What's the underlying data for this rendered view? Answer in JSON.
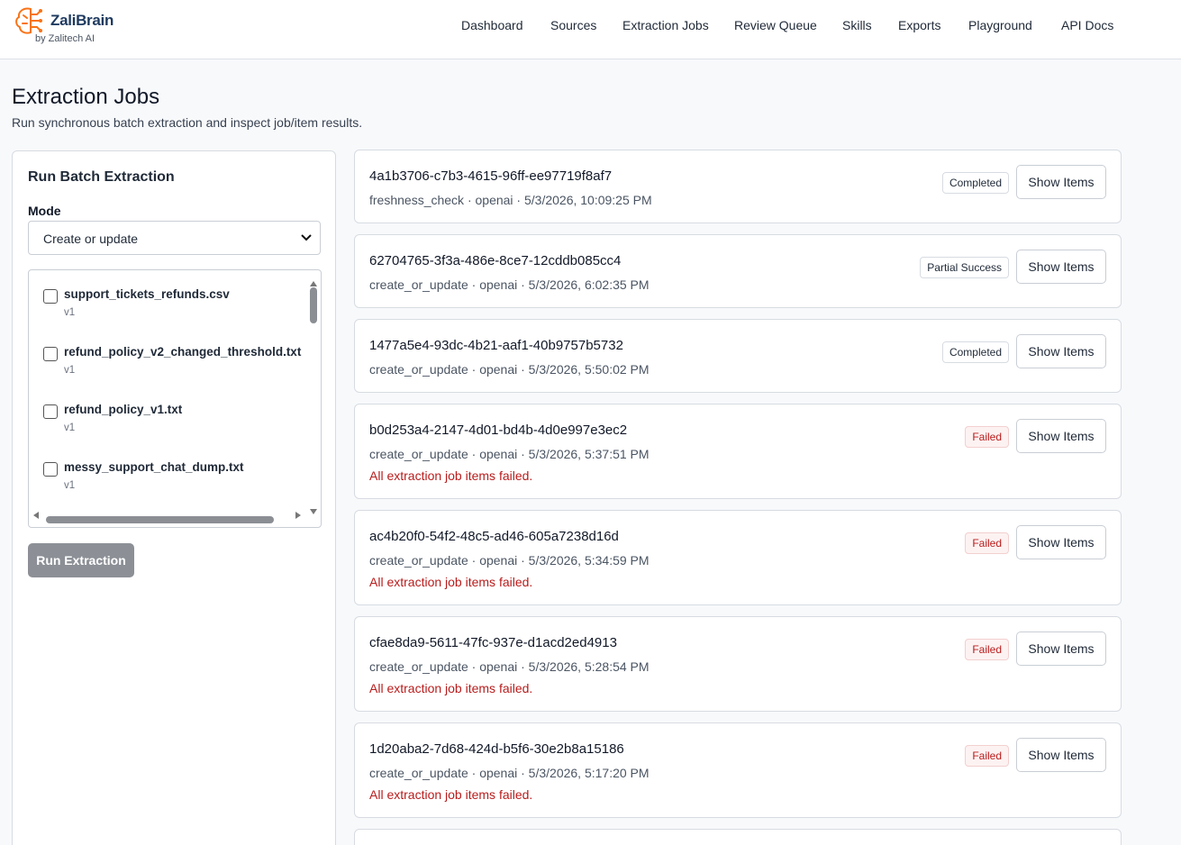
{
  "brand": {
    "name": "ZaliBrain",
    "tagline": "by Zalitech AI",
    "accent": "#f97316",
    "text_color": "#1e3a5f"
  },
  "nav": {
    "items": [
      {
        "label": "Dashboard"
      },
      {
        "label": "Sources"
      },
      {
        "label": "Extraction Jobs"
      },
      {
        "label": "Review Queue"
      },
      {
        "label": "Skills"
      },
      {
        "label": "Exports"
      },
      {
        "label": "Playground"
      },
      {
        "label": "API Docs"
      }
    ]
  },
  "page": {
    "title": "Extraction Jobs",
    "subtitle": "Run synchronous batch extraction and inspect job/item results."
  },
  "batch": {
    "title": "Run Batch Extraction",
    "mode_label": "Mode",
    "mode_value": "Create or update",
    "files": [
      {
        "name": "support_tickets_refunds.csv",
        "version": "v1",
        "checked": false
      },
      {
        "name": "refund_policy_v2_changed_threshold.txt",
        "version": "v1",
        "checked": false
      },
      {
        "name": "refund_policy_v1.txt",
        "version": "v1",
        "checked": false
      },
      {
        "name": "messy_support_chat_dump.txt",
        "version": "v1",
        "checked": false
      }
    ],
    "run_label": "Run Extraction",
    "run_disabled": true
  },
  "jobs": [
    {
      "id": "4a1b3706-c7b3-4615-96ff-ee97719f8af7",
      "meta": "freshness_check · openai · 5/3/2026, 10:09:25 PM",
      "status": "Completed",
      "error": "",
      "action": "Show Items"
    },
    {
      "id": "62704765-3f3a-486e-8ce7-12cddb085cc4",
      "meta": "create_or_update · openai · 5/3/2026, 6:02:35 PM",
      "status": "Partial Success",
      "error": "",
      "action": "Show Items"
    },
    {
      "id": "1477a5e4-93dc-4b21-aaf1-40b9757b5732",
      "meta": "create_or_update · openai · 5/3/2026, 5:50:02 PM",
      "status": "Completed",
      "error": "",
      "action": "Show Items"
    },
    {
      "id": "b0d253a4-2147-4d01-bd4b-4d0e997e3ec2",
      "meta": "create_or_update · openai · 5/3/2026, 5:37:51 PM",
      "status": "Failed",
      "error": "All extraction job items failed.",
      "action": "Show Items"
    },
    {
      "id": "ac4b20f0-54f2-48c5-ad46-605a7238d16d",
      "meta": "create_or_update · openai · 5/3/2026, 5:34:59 PM",
      "status": "Failed",
      "error": "All extraction job items failed.",
      "action": "Show Items"
    },
    {
      "id": "cfae8da9-5611-47fc-937e-d1acd2ed4913",
      "meta": "create_or_update · openai · 5/3/2026, 5:28:54 PM",
      "status": "Failed",
      "error": "All extraction job items failed.",
      "action": "Show Items"
    },
    {
      "id": "1d20aba2-7d68-424d-b5f6-30e2b8a15186",
      "meta": "create_or_update · openai · 5/3/2026, 5:17:20 PM",
      "status": "Failed",
      "error": "All extraction job items failed.",
      "action": "Show Items"
    }
  ]
}
